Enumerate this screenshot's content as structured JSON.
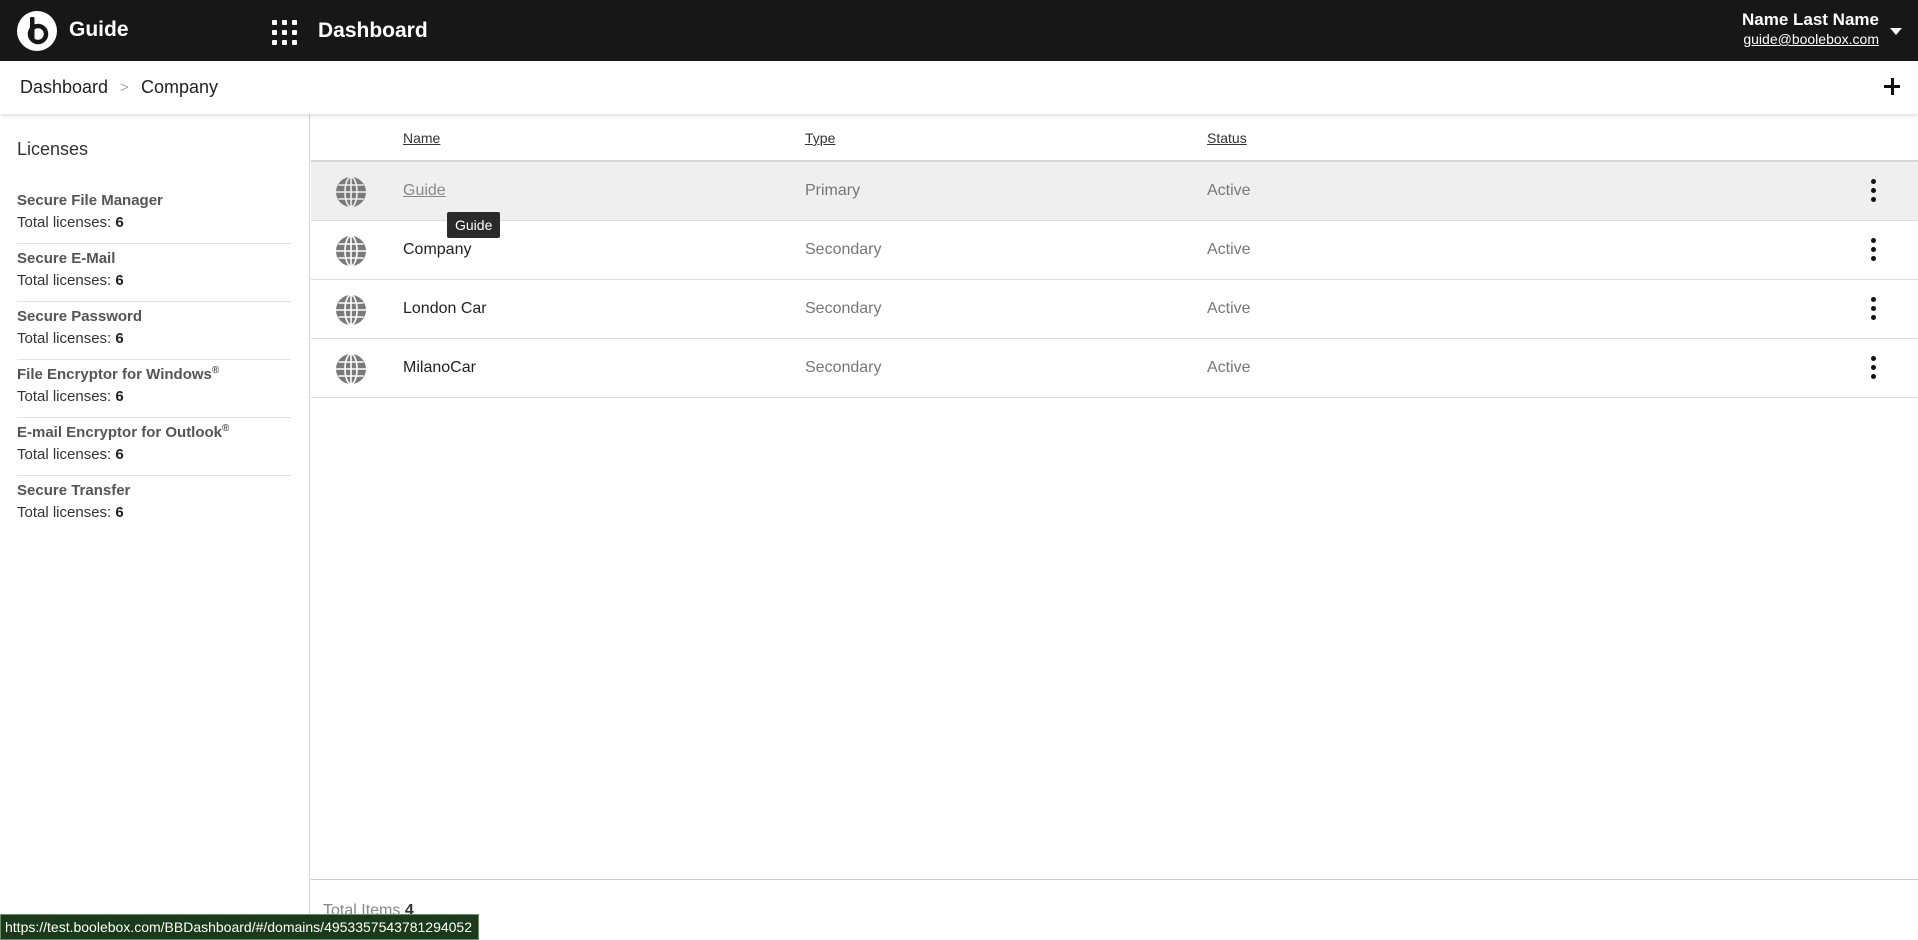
{
  "header": {
    "app_name": "Guide",
    "page_name": "Dashboard",
    "user_name": "Name Last Name",
    "user_email": "guide@boolebox.com"
  },
  "breadcrumb": {
    "items": [
      "Dashboard",
      "Company"
    ],
    "separator": ">"
  },
  "sidebar": {
    "title": "Licenses",
    "total_label": "Total licenses:",
    "items": [
      {
        "name": "Secure File Manager",
        "reg": "",
        "total": "6"
      },
      {
        "name": "Secure E-Mail",
        "reg": "",
        "total": "6"
      },
      {
        "name": "Secure Password",
        "reg": "",
        "total": "6"
      },
      {
        "name": "File Encryptor for Windows",
        "reg": "®",
        "total": "6"
      },
      {
        "name": "E-mail Encryptor for Outlook",
        "reg": "®",
        "total": "6"
      },
      {
        "name": "Secure Transfer",
        "reg": "",
        "total": "6"
      }
    ]
  },
  "table": {
    "columns": {
      "name": "Name",
      "type": "Type",
      "status": "Status"
    },
    "rows": [
      {
        "name": "Guide",
        "type": "Primary",
        "status": "Active",
        "icon": "globe-icon"
      },
      {
        "name": "Company",
        "type": "Secondary",
        "status": "Active",
        "icon": "globe-icon"
      },
      {
        "name": "London Car",
        "type": "Secondary",
        "status": "Active",
        "icon": "globe-icon"
      },
      {
        "name": "MilanoCar",
        "type": "Secondary",
        "status": "Active",
        "icon": "globe-icon"
      }
    ],
    "tooltip": "Guide"
  },
  "footer": {
    "label": "Total Items",
    "count": "4"
  },
  "status_bar": {
    "url": "https://test.boolebox.com/BBDashboard/#/domains/4953357543781294052"
  },
  "colors": {
    "topbar": "#171717",
    "hover_row": "#efefef",
    "status_bar": "#1b3a1b"
  }
}
